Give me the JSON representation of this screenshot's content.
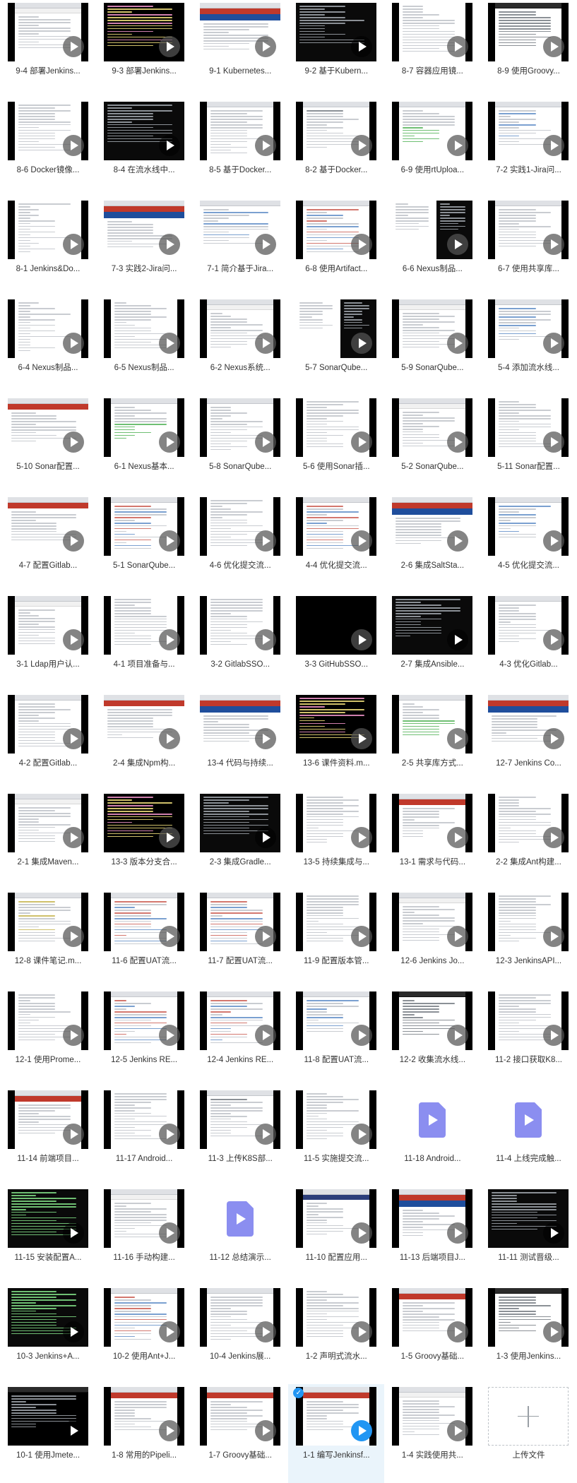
{
  "page": {
    "type": "video-library-grid",
    "columns": 6,
    "selected_index": 75,
    "accent_color": "#2196f3",
    "selected_bg": "#eaf4fb",
    "thumb_bg": "#000000",
    "label_color": "#333333"
  },
  "upload_tile": {
    "label": "上传文件",
    "icon": "plus-icon"
  },
  "items": [
    {
      "label": "9-4 部署Jenkins...",
      "style": "browser-form",
      "frame": "mid"
    },
    {
      "label": "9-3 部署Jenkins...",
      "style": "code-dark",
      "frame": "wide"
    },
    {
      "label": "9-1 Kubernetes...",
      "style": "slide-blue",
      "frame": "wide"
    },
    {
      "label": "9-2 基于Kubern...",
      "style": "terminal",
      "frame": "wide",
      "play": "dark"
    },
    {
      "label": "8-7 容器应用镜...",
      "style": "doc-text",
      "frame": "mid"
    },
    {
      "label": "8-9 使用Groovy...",
      "style": "browser-dark",
      "frame": "mid"
    },
    {
      "label": "8-6 Docker镜像...",
      "style": "doc-text",
      "frame": "mid"
    },
    {
      "label": "8-4 在流水线中...",
      "style": "terminal",
      "frame": "wide",
      "play": "dark"
    },
    {
      "label": "8-5 基于Docker...",
      "style": "code-light",
      "frame": "mid"
    },
    {
      "label": "8-2 基于Docker...",
      "style": "jenkins-doc",
      "frame": "mid"
    },
    {
      "label": "6-9 使用rtUploa...",
      "style": "table-green",
      "frame": "mid"
    },
    {
      "label": "7-2 实践1-Jira问...",
      "style": "form-blue",
      "frame": "mid"
    },
    {
      "label": "8-1 Jenkins&Do...",
      "style": "doc-outline",
      "frame": "mid"
    },
    {
      "label": "7-3 实践2-Jira问...",
      "style": "slide-blue",
      "frame": "wide"
    },
    {
      "label": "7-1 简介基于Jira...",
      "style": "form-blue",
      "frame": "wide"
    },
    {
      "label": "6-8 使用Artifact...",
      "style": "code-color",
      "frame": "mid"
    },
    {
      "label": "6-6 Nexus制品...",
      "style": "split-dark",
      "frame": "wide"
    },
    {
      "label": "6-7 使用共享库...",
      "style": "browser-doc",
      "frame": "mid"
    },
    {
      "label": "6-4 Nexus制品...",
      "style": "doc-outline",
      "frame": "mid"
    },
    {
      "label": "6-5 Nexus制品...",
      "style": "doc-text",
      "frame": "mid"
    },
    {
      "label": "6-2 Nexus系统...",
      "style": "browser-light",
      "frame": "mid"
    },
    {
      "label": "5-7 SonarQube...",
      "style": "split-dark",
      "frame": "wide"
    },
    {
      "label": "5-9 SonarQube...",
      "style": "browser-light",
      "frame": "mid"
    },
    {
      "label": "5-4 添加流水线...",
      "style": "table-blue",
      "frame": "mid"
    },
    {
      "label": "5-10 Sonar配置...",
      "style": "slide-red",
      "frame": "wide"
    },
    {
      "label": "6-1 Nexus基本...",
      "style": "table-green",
      "frame": "mid"
    },
    {
      "label": "5-8 SonarQube...",
      "style": "code-light",
      "frame": "mid"
    },
    {
      "label": "5-6 使用Sonar插...",
      "style": "doc-text",
      "frame": "mid"
    },
    {
      "label": "5-2 SonarQube...",
      "style": "browser-light",
      "frame": "mid"
    },
    {
      "label": "5-11 Sonar配置...",
      "style": "doc-text",
      "frame": "mid"
    },
    {
      "label": "4-7 配置Gitlab...",
      "style": "slide-red",
      "frame": "wide"
    },
    {
      "label": "5-1 SonarQube...",
      "style": "code-color",
      "frame": "mid"
    },
    {
      "label": "4-6 优化提交流...",
      "style": "doc-text",
      "frame": "mid"
    },
    {
      "label": "4-4 优化提交流...",
      "style": "code-color",
      "frame": "mid"
    },
    {
      "label": "2-6 集成SaltSta...",
      "style": "slide-blue",
      "frame": "wide"
    },
    {
      "label": "4-5 优化提交流...",
      "style": "table-blue",
      "frame": "mid"
    },
    {
      "label": "3-1 Ldap用户认...",
      "style": "browser-light",
      "frame": "mid"
    },
    {
      "label": "4-1 项目准备与...",
      "style": "doc-text",
      "frame": "mid"
    },
    {
      "label": "3-2 GitlabSSO...",
      "style": "doc-text",
      "frame": "mid"
    },
    {
      "label": "3-3 GitHubSSO...",
      "style": "dark-photo",
      "frame": "wide"
    },
    {
      "label": "2-7 集成Ansible...",
      "style": "terminal",
      "frame": "wide",
      "play": "dark"
    },
    {
      "label": "4-3 优化Gitlab...",
      "style": "browser-doc",
      "frame": "mid"
    },
    {
      "label": "4-2 配置Gitlab...",
      "style": "code-light",
      "frame": "mid"
    },
    {
      "label": "2-4 集成Npm构...",
      "style": "slide-red",
      "frame": "wide"
    },
    {
      "label": "13-4 代码与持续...",
      "style": "slide-blue",
      "frame": "wide"
    },
    {
      "label": "13-6 课件资料.m...",
      "style": "code-dark",
      "frame": "wide"
    },
    {
      "label": "2-5 共享库方式...",
      "style": "table-green",
      "frame": "mid"
    },
    {
      "label": "12-7 Jenkins Co...",
      "style": "slide-blue",
      "frame": "wide"
    },
    {
      "label": "2-1 集成Maven...",
      "style": "browser-light",
      "frame": "mid"
    },
    {
      "label": "13-3 版本分支合...",
      "style": "code-dark",
      "frame": "wide"
    },
    {
      "label": "2-3 集成Gradle...",
      "style": "terminal",
      "frame": "wide",
      "play": "dark"
    },
    {
      "label": "13-5 持续集成与...",
      "style": "doc-text",
      "frame": "mid"
    },
    {
      "label": "13-1 需求与代码...",
      "style": "slide-red",
      "frame": "mid"
    },
    {
      "label": "2-2 集成Ant构建...",
      "style": "doc-text",
      "frame": "mid"
    },
    {
      "label": "12-8 课件笔记.m...",
      "style": "code-yellow",
      "frame": "mid"
    },
    {
      "label": "11-6 配置UAT流...",
      "style": "code-color",
      "frame": "mid"
    },
    {
      "label": "11-7 配置UAT流...",
      "style": "code-color",
      "frame": "mid"
    },
    {
      "label": "11-9 配置版本管...",
      "style": "doc-text",
      "frame": "mid"
    },
    {
      "label": "12-6 Jenkins Jo...",
      "style": "browser-light",
      "frame": "mid"
    },
    {
      "label": "12-3 JenkinsAPI...",
      "style": "doc-text",
      "frame": "mid"
    },
    {
      "label": "12-1 使用Prome...",
      "style": "doc-text",
      "frame": "mid"
    },
    {
      "label": "12-5 Jenkins RE...",
      "style": "code-color",
      "frame": "mid"
    },
    {
      "label": "12-4 Jenkins RE...",
      "style": "code-color",
      "frame": "mid"
    },
    {
      "label": "11-8 配置UAT流...",
      "style": "table-blue",
      "frame": "mid"
    },
    {
      "label": "12-2 收集流水线...",
      "style": "browser-dark",
      "frame": "mid"
    },
    {
      "label": "11-2 接口获取K8...",
      "style": "doc-text",
      "frame": "mid"
    },
    {
      "label": "11-14 前端项目...",
      "style": "slide-red",
      "frame": "mid"
    },
    {
      "label": "11-17 Android...",
      "style": "doc-text",
      "frame": "mid"
    },
    {
      "label": "11-3 上传K8S部...",
      "style": "jenkins-doc",
      "frame": "mid"
    },
    {
      "label": "11-5 实施提交流...",
      "style": "doc-text",
      "frame": "mid"
    },
    {
      "label": "11-18 Android...",
      "style": "file-purple",
      "frame": "wide",
      "play": "plain"
    },
    {
      "label": "11-4 上线完成触...",
      "style": "file-purple",
      "frame": "wide",
      "play": "plain"
    },
    {
      "label": "11-15 安装配置A...",
      "style": "terminal-green",
      "frame": "wide",
      "play": "dark"
    },
    {
      "label": "11-16 手动构建...",
      "style": "browser-light",
      "frame": "mid"
    },
    {
      "label": "11-12 总结演示...",
      "style": "file-purple",
      "frame": "wide",
      "play": "plain"
    },
    {
      "label": "11-10 配置应用...",
      "style": "browser-navy",
      "frame": "mid"
    },
    {
      "label": "11-13 后端项目J...",
      "style": "slide-blue",
      "frame": "mid"
    },
    {
      "label": "11-11 测试晋级...",
      "style": "terminal",
      "frame": "wide",
      "play": "dark"
    },
    {
      "label": "10-3 Jenkins+A...",
      "style": "terminal-green",
      "frame": "wide",
      "play": "dark"
    },
    {
      "label": "10-2 使用Ant+J...",
      "style": "code-color",
      "frame": "mid"
    },
    {
      "label": "10-4 Jenkins展...",
      "style": "code-light",
      "frame": "mid"
    },
    {
      "label": "1-2 声明式流水...",
      "style": "doc-text",
      "frame": "mid"
    },
    {
      "label": "1-5 Groovy基础...",
      "style": "slide-red",
      "frame": "mid"
    },
    {
      "label": "1-3 使用Jenkins...",
      "style": "browser-dark",
      "frame": "mid"
    },
    {
      "label": "10-1 使用Jmete...",
      "style": "ide-dark",
      "frame": "wide",
      "play": "dark"
    },
    {
      "label": "1-8 常用的Pipeli...",
      "style": "slide-red",
      "frame": "mid"
    },
    {
      "label": "1-7 Groovy基础...",
      "style": "slide-red",
      "frame": "mid"
    },
    {
      "label": "1-1 编写Jenkinsf...",
      "style": "slide-red",
      "frame": "mid",
      "selected": true,
      "play": "blue"
    },
    {
      "label": "1-4 实践使用共...",
      "style": "browser-light",
      "frame": "mid"
    }
  ]
}
